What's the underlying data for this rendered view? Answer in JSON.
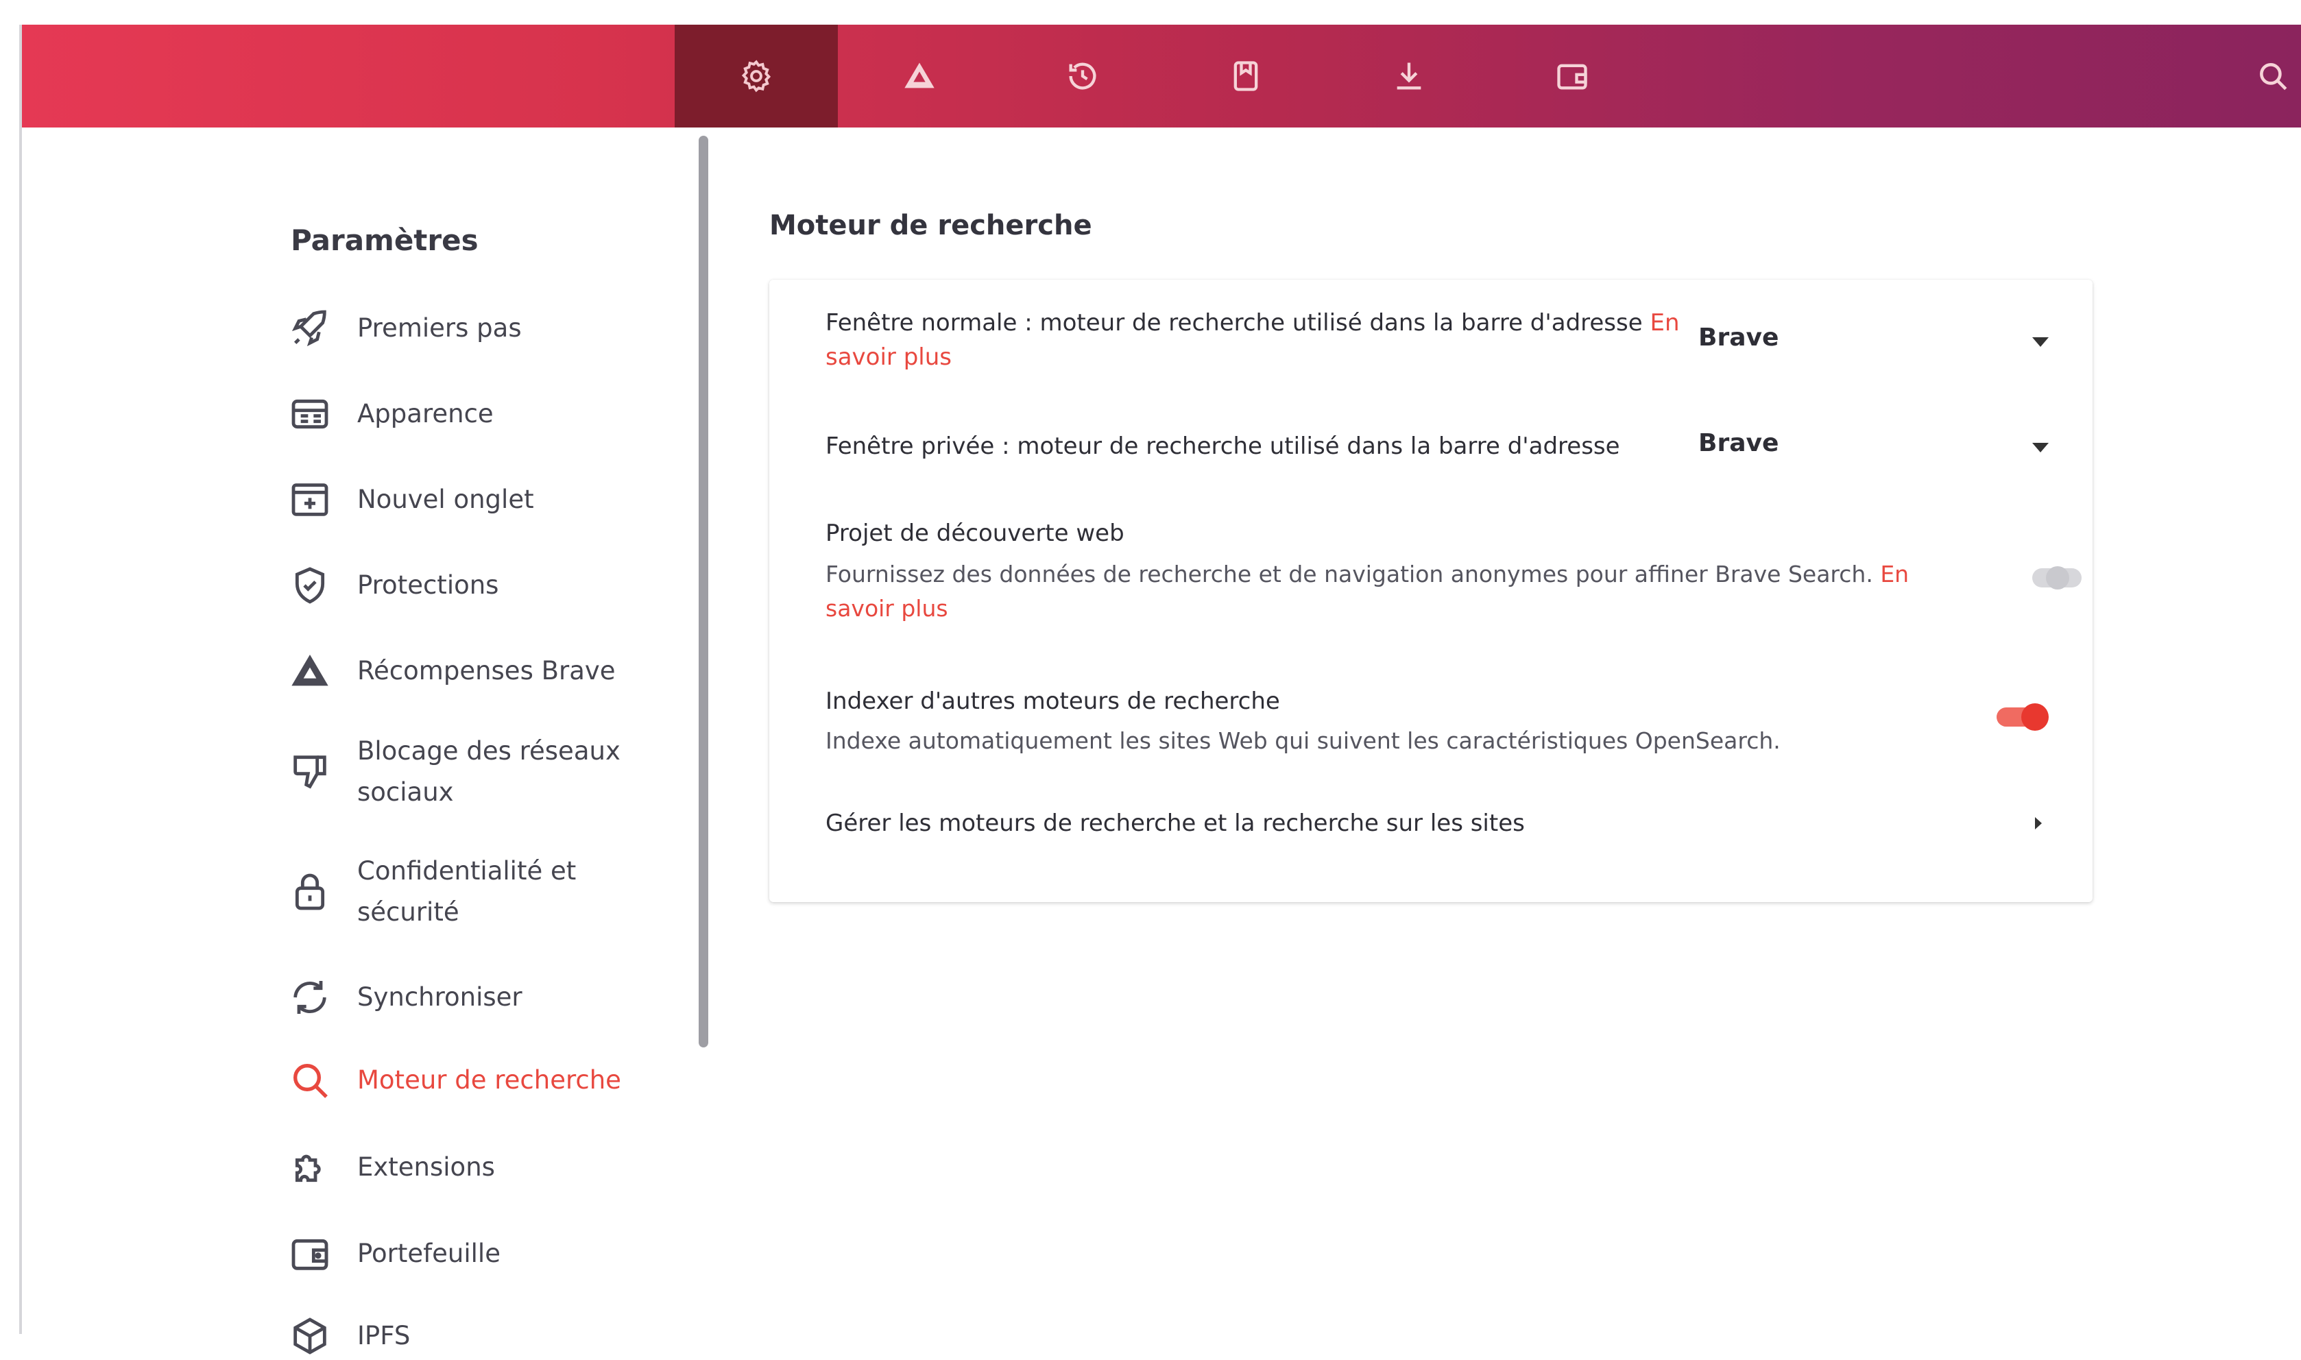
{
  "colors": {
    "accent": "#e8483f",
    "topbar_start": "#e53954",
    "topbar_end": "#8b245d",
    "active_tab": "#7d1d2c"
  },
  "topbar": {
    "tabs": [
      {
        "icon": "settings-icon",
        "active": true
      },
      {
        "icon": "rewards-triangle-icon",
        "active": false
      },
      {
        "icon": "history-icon",
        "active": false
      },
      {
        "icon": "bookmarks-icon",
        "active": false
      },
      {
        "icon": "download-icon",
        "active": false
      },
      {
        "icon": "wallet-icon",
        "active": false
      }
    ],
    "search_icon": "search-icon"
  },
  "sidebar": {
    "title": "Paramètres",
    "items": [
      {
        "label": "Premiers pas",
        "icon": "rocket-icon"
      },
      {
        "label": "Apparence",
        "icon": "appearance-icon"
      },
      {
        "label": "Nouvel onglet",
        "icon": "new-tab-icon"
      },
      {
        "label": "Protections",
        "icon": "shield-icon"
      },
      {
        "label": "Récompenses Brave",
        "icon": "rewards-triangle-icon"
      },
      {
        "label": "Blocage des réseaux sociaux",
        "icon": "thumbs-down-icon"
      },
      {
        "label": "Confidentialité et sécurité",
        "icon": "lock-icon"
      },
      {
        "label": "Synchroniser",
        "icon": "sync-icon"
      },
      {
        "label": "Moteur de recherche",
        "icon": "search-icon",
        "active": true
      },
      {
        "label": "Extensions",
        "icon": "puzzle-icon"
      },
      {
        "label": "Portefeuille",
        "icon": "wallet-icon"
      },
      {
        "label": "IPFS",
        "icon": "cube-icon"
      }
    ]
  },
  "main": {
    "title": "Moteur de recherche",
    "normal_window": {
      "label": "Fenêtre normale : moteur de recherche utilisé dans la barre d'adresse",
      "link": "En savoir plus",
      "value": "Brave"
    },
    "private_window": {
      "label": "Fenêtre privée : moteur de recherche utilisé dans la barre d'adresse",
      "value": "Brave"
    },
    "web_discovery": {
      "label": "Projet de découverte web",
      "desc": "Fournissez des données de recherche et de navigation anonymes pour affiner Brave Search.",
      "link": "En savoir plus",
      "enabled": false
    },
    "index_engines": {
      "label": "Indexer d'autres moteurs de recherche",
      "desc": "Indexe automatiquement les sites Web qui suivent les caractéristiques OpenSearch.",
      "enabled": true
    },
    "manage": {
      "label": "Gérer les moteurs de recherche et la recherche sur les sites"
    }
  }
}
